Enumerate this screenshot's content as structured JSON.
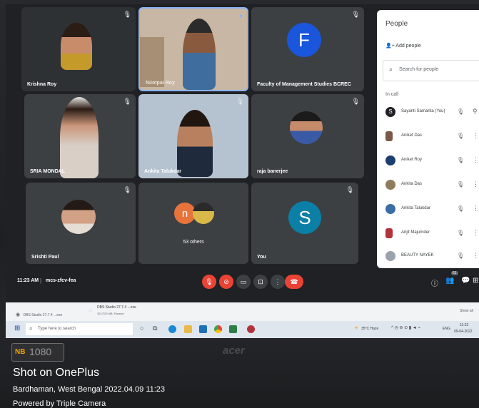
{
  "meet": {
    "tiles": [
      {
        "name": "Krishna Roy"
      },
      {
        "name": "Nilotpal Roy"
      },
      {
        "name": "Faculty of Management Studies BCREC",
        "initial": "F"
      },
      {
        "name": "SRIA MONDAL"
      },
      {
        "name": "Ankita Talukdar"
      },
      {
        "name": "raja banerjee"
      },
      {
        "name": "Srishti Paul"
      },
      {
        "name": "53 others",
        "initial": "n"
      },
      {
        "name": "You",
        "initial": "S"
      }
    ],
    "meeting_time": "11:23 AM",
    "meeting_code": "mcs-zfcv-fea",
    "participant_count": "61"
  },
  "people": {
    "title": "People",
    "add_people": "Add people",
    "search_placeholder": "Search for people",
    "in_call": "In call",
    "list": [
      {
        "name": "Sayanti Samanta (You)",
        "initial": "S"
      },
      {
        "name": "Aniket Das"
      },
      {
        "name": "Aniket Roy"
      },
      {
        "name": "Ankita Das"
      },
      {
        "name": "Ankita Talukdar"
      },
      {
        "name": "Arijit Majumder"
      },
      {
        "name": "BEAUTY NAYEK"
      }
    ]
  },
  "downloads": {
    "item1": "DBS Studio 27.7.4 ...exe",
    "item2": "DBS Studio 27.7.4 ...exe",
    "item2_sub": "321/720 MB, Paused",
    "show_all": "Show all"
  },
  "taskbar": {
    "search_placeholder": "Type here to search",
    "weather": "35°C Haze",
    "lang": "ENG",
    "time": "11:23",
    "date": "09-04-2022"
  },
  "watermark": {
    "brand": "acer",
    "badge": "1080",
    "badge_prefix": "NB",
    "shot_on": "Shot on OnePlus",
    "location_date": "Bardhaman, West Bengal  2022.04.09 11:23",
    "powered": "Powered by Triple Camera"
  },
  "colors": {
    "meet_bg": "#202124",
    "tile_bg": "#3c4043",
    "avatar_blue": "#1a56db",
    "avatar_orange": "#e8743b",
    "avatar_teal": "#0b7fa5",
    "end_call": "#ea4335"
  }
}
